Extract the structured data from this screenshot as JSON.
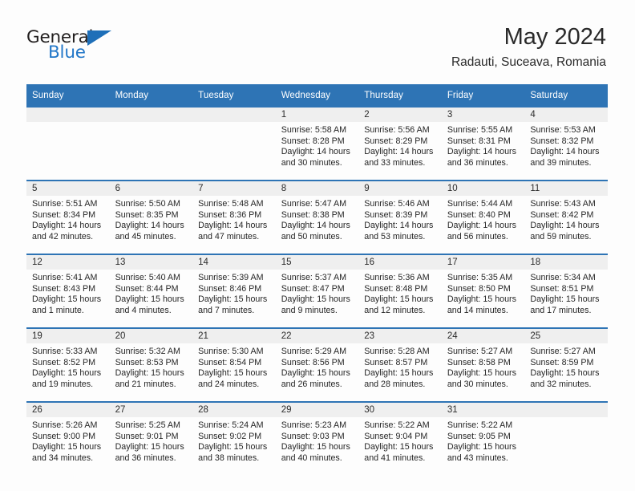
{
  "brand": {
    "name_top": "General",
    "name_bottom": "Blue",
    "triangle_color": "#1e6fb8",
    "blue_text_color": "#2277c8"
  },
  "header": {
    "month_title": "May 2024",
    "location": "Radauti, Suceava, Romania"
  },
  "theme": {
    "header_blue": "#2e74b5",
    "daynum_strip_gray": "#efefef",
    "page_background": "#fdfdfd",
    "text_color": "#262626"
  },
  "columns": [
    "Sunday",
    "Monday",
    "Tuesday",
    "Wednesday",
    "Thursday",
    "Friday",
    "Saturday"
  ],
  "weeks": [
    [
      {
        "day": "",
        "lines": []
      },
      {
        "day": "",
        "lines": []
      },
      {
        "day": "",
        "lines": []
      },
      {
        "day": "1",
        "lines": [
          "Sunrise: 5:58 AM",
          "Sunset: 8:28 PM",
          "Daylight: 14 hours",
          "and 30 minutes."
        ]
      },
      {
        "day": "2",
        "lines": [
          "Sunrise: 5:56 AM",
          "Sunset: 8:29 PM",
          "Daylight: 14 hours",
          "and 33 minutes."
        ]
      },
      {
        "day": "3",
        "lines": [
          "Sunrise: 5:55 AM",
          "Sunset: 8:31 PM",
          "Daylight: 14 hours",
          "and 36 minutes."
        ]
      },
      {
        "day": "4",
        "lines": [
          "Sunrise: 5:53 AM",
          "Sunset: 8:32 PM",
          "Daylight: 14 hours",
          "and 39 minutes."
        ]
      }
    ],
    [
      {
        "day": "5",
        "lines": [
          "Sunrise: 5:51 AM",
          "Sunset: 8:34 PM",
          "Daylight: 14 hours",
          "and 42 minutes."
        ]
      },
      {
        "day": "6",
        "lines": [
          "Sunrise: 5:50 AM",
          "Sunset: 8:35 PM",
          "Daylight: 14 hours",
          "and 45 minutes."
        ]
      },
      {
        "day": "7",
        "lines": [
          "Sunrise: 5:48 AM",
          "Sunset: 8:36 PM",
          "Daylight: 14 hours",
          "and 47 minutes."
        ]
      },
      {
        "day": "8",
        "lines": [
          "Sunrise: 5:47 AM",
          "Sunset: 8:38 PM",
          "Daylight: 14 hours",
          "and 50 minutes."
        ]
      },
      {
        "day": "9",
        "lines": [
          "Sunrise: 5:46 AM",
          "Sunset: 8:39 PM",
          "Daylight: 14 hours",
          "and 53 minutes."
        ]
      },
      {
        "day": "10",
        "lines": [
          "Sunrise: 5:44 AM",
          "Sunset: 8:40 PM",
          "Daylight: 14 hours",
          "and 56 minutes."
        ]
      },
      {
        "day": "11",
        "lines": [
          "Sunrise: 5:43 AM",
          "Sunset: 8:42 PM",
          "Daylight: 14 hours",
          "and 59 minutes."
        ]
      }
    ],
    [
      {
        "day": "12",
        "lines": [
          "Sunrise: 5:41 AM",
          "Sunset: 8:43 PM",
          "Daylight: 15 hours",
          "and 1 minute."
        ]
      },
      {
        "day": "13",
        "lines": [
          "Sunrise: 5:40 AM",
          "Sunset: 8:44 PM",
          "Daylight: 15 hours",
          "and 4 minutes."
        ]
      },
      {
        "day": "14",
        "lines": [
          "Sunrise: 5:39 AM",
          "Sunset: 8:46 PM",
          "Daylight: 15 hours",
          "and 7 minutes."
        ]
      },
      {
        "day": "15",
        "lines": [
          "Sunrise: 5:37 AM",
          "Sunset: 8:47 PM",
          "Daylight: 15 hours",
          "and 9 minutes."
        ]
      },
      {
        "day": "16",
        "lines": [
          "Sunrise: 5:36 AM",
          "Sunset: 8:48 PM",
          "Daylight: 15 hours",
          "and 12 minutes."
        ]
      },
      {
        "day": "17",
        "lines": [
          "Sunrise: 5:35 AM",
          "Sunset: 8:50 PM",
          "Daylight: 15 hours",
          "and 14 minutes."
        ]
      },
      {
        "day": "18",
        "lines": [
          "Sunrise: 5:34 AM",
          "Sunset: 8:51 PM",
          "Daylight: 15 hours",
          "and 17 minutes."
        ]
      }
    ],
    [
      {
        "day": "19",
        "lines": [
          "Sunrise: 5:33 AM",
          "Sunset: 8:52 PM",
          "Daylight: 15 hours",
          "and 19 minutes."
        ]
      },
      {
        "day": "20",
        "lines": [
          "Sunrise: 5:32 AM",
          "Sunset: 8:53 PM",
          "Daylight: 15 hours",
          "and 21 minutes."
        ]
      },
      {
        "day": "21",
        "lines": [
          "Sunrise: 5:30 AM",
          "Sunset: 8:54 PM",
          "Daylight: 15 hours",
          "and 24 minutes."
        ]
      },
      {
        "day": "22",
        "lines": [
          "Sunrise: 5:29 AM",
          "Sunset: 8:56 PM",
          "Daylight: 15 hours",
          "and 26 minutes."
        ]
      },
      {
        "day": "23",
        "lines": [
          "Sunrise: 5:28 AM",
          "Sunset: 8:57 PM",
          "Daylight: 15 hours",
          "and 28 minutes."
        ]
      },
      {
        "day": "24",
        "lines": [
          "Sunrise: 5:27 AM",
          "Sunset: 8:58 PM",
          "Daylight: 15 hours",
          "and 30 minutes."
        ]
      },
      {
        "day": "25",
        "lines": [
          "Sunrise: 5:27 AM",
          "Sunset: 8:59 PM",
          "Daylight: 15 hours",
          "and 32 minutes."
        ]
      }
    ],
    [
      {
        "day": "26",
        "lines": [
          "Sunrise: 5:26 AM",
          "Sunset: 9:00 PM",
          "Daylight: 15 hours",
          "and 34 minutes."
        ]
      },
      {
        "day": "27",
        "lines": [
          "Sunrise: 5:25 AM",
          "Sunset: 9:01 PM",
          "Daylight: 15 hours",
          "and 36 minutes."
        ]
      },
      {
        "day": "28",
        "lines": [
          "Sunrise: 5:24 AM",
          "Sunset: 9:02 PM",
          "Daylight: 15 hours",
          "and 38 minutes."
        ]
      },
      {
        "day": "29",
        "lines": [
          "Sunrise: 5:23 AM",
          "Sunset: 9:03 PM",
          "Daylight: 15 hours",
          "and 40 minutes."
        ]
      },
      {
        "day": "30",
        "lines": [
          "Sunrise: 5:22 AM",
          "Sunset: 9:04 PM",
          "Daylight: 15 hours",
          "and 41 minutes."
        ]
      },
      {
        "day": "31",
        "lines": [
          "Sunrise: 5:22 AM",
          "Sunset: 9:05 PM",
          "Daylight: 15 hours",
          "and 43 minutes."
        ]
      },
      {
        "day": "",
        "lines": []
      }
    ]
  ]
}
